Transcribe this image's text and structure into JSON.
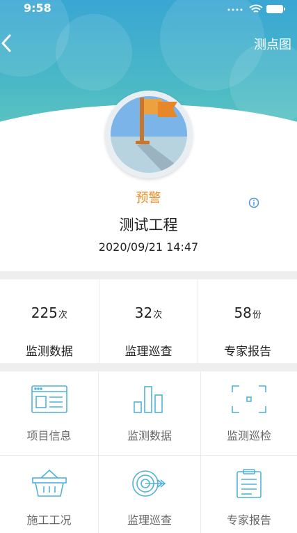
{
  "status_bar": {
    "time": "9:58"
  },
  "nav": {
    "right_label": "测点图",
    "back_icon": "chevron-left-icon"
  },
  "project": {
    "status": "预警",
    "name": "测试工程",
    "datetime": "2020/09/21 14:47",
    "status_color": "#f08a24"
  },
  "stats": [
    {
      "value": "225",
      "unit": "次",
      "label": "监测数据"
    },
    {
      "value": "32",
      "unit": "次",
      "label": "监理巡查"
    },
    {
      "value": "58",
      "unit": "份",
      "label": "专家报告"
    }
  ],
  "menu": [
    {
      "label": "项目信息",
      "icon": "browser-window-icon"
    },
    {
      "label": "监测数据",
      "icon": "bar-chart-icon"
    },
    {
      "label": "监测巡检",
      "icon": "scan-frame-icon"
    },
    {
      "label": "施工工况",
      "icon": "basket-icon"
    },
    {
      "label": "监理巡查",
      "icon": "target-icon"
    },
    {
      "label": "专家报告",
      "icon": "clipboard-icon"
    }
  ],
  "colors": {
    "accent": "#4fb2d8",
    "icon_stroke": "#4fb2d8"
  }
}
